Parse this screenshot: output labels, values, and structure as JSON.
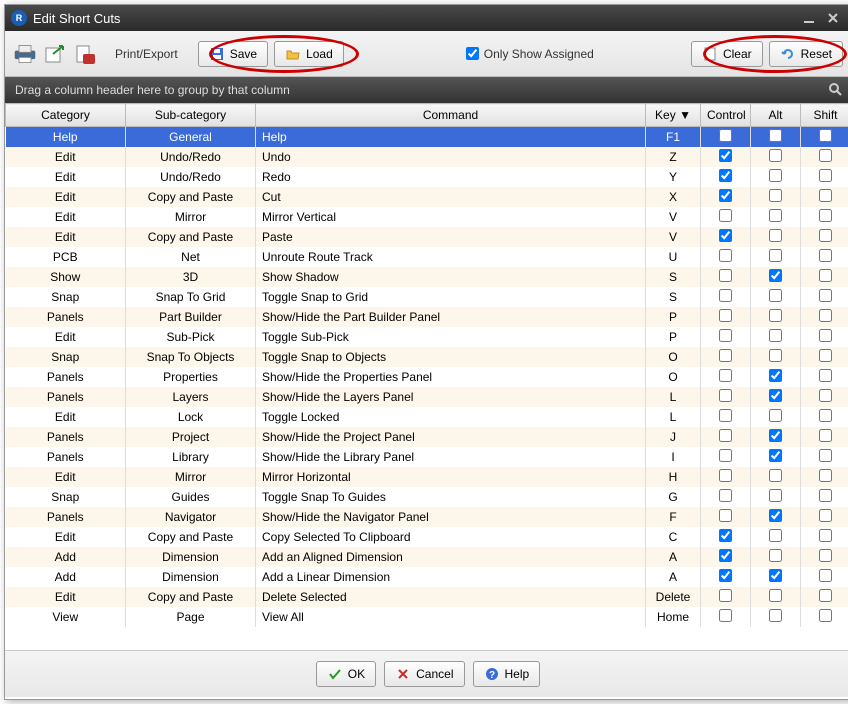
{
  "window": {
    "title": "Edit Short Cuts"
  },
  "toolbar": {
    "print_export_label": "Print/Export",
    "save_label": "Save",
    "load_label": "Load",
    "only_show_assigned_label": "Only Show Assigned",
    "only_show_assigned_checked": true,
    "clear_label": "Clear",
    "reset_label": "Reset"
  },
  "group_hint": "Drag a column header here to group by that column",
  "columns": {
    "category": "Category",
    "sub_category": "Sub-category",
    "command": "Command",
    "key": "Key",
    "control": "Control",
    "alt": "Alt",
    "shift": "Shift"
  },
  "rows": [
    {
      "category": "Help",
      "sub": "General",
      "command": "Help",
      "key": "F1",
      "ctrl": false,
      "alt": false,
      "shift": false,
      "selected": true
    },
    {
      "category": "Edit",
      "sub": "Undo/Redo",
      "command": "Undo",
      "key": "Z",
      "ctrl": true,
      "alt": false,
      "shift": false
    },
    {
      "category": "Edit",
      "sub": "Undo/Redo",
      "command": "Redo",
      "key": "Y",
      "ctrl": true,
      "alt": false,
      "shift": false
    },
    {
      "category": "Edit",
      "sub": "Copy and Paste",
      "command": "Cut",
      "key": "X",
      "ctrl": true,
      "alt": false,
      "shift": false
    },
    {
      "category": "Edit",
      "sub": "Mirror",
      "command": "Mirror Vertical",
      "key": "V",
      "ctrl": false,
      "alt": false,
      "shift": false
    },
    {
      "category": "Edit",
      "sub": "Copy and Paste",
      "command": "Paste",
      "key": "V",
      "ctrl": true,
      "alt": false,
      "shift": false
    },
    {
      "category": "PCB",
      "sub": "Net",
      "command": "Unroute Route Track",
      "key": "U",
      "ctrl": false,
      "alt": false,
      "shift": false
    },
    {
      "category": "Show",
      "sub": "3D",
      "command": "Show Shadow",
      "key": "S",
      "ctrl": false,
      "alt": true,
      "shift": false
    },
    {
      "category": "Snap",
      "sub": "Snap To Grid",
      "command": "Toggle Snap to Grid",
      "key": "S",
      "ctrl": false,
      "alt": false,
      "shift": false
    },
    {
      "category": "Panels",
      "sub": "Part Builder",
      "command": "Show/Hide the Part Builder Panel",
      "key": "P",
      "ctrl": false,
      "alt": false,
      "shift": false
    },
    {
      "category": "Edit",
      "sub": "Sub-Pick",
      "command": "Toggle Sub-Pick",
      "key": "P",
      "ctrl": false,
      "alt": false,
      "shift": false
    },
    {
      "category": "Snap",
      "sub": "Snap To Objects",
      "command": "Toggle Snap to Objects",
      "key": "O",
      "ctrl": false,
      "alt": false,
      "shift": false
    },
    {
      "category": "Panels",
      "sub": "Properties",
      "command": "Show/Hide the Properties Panel",
      "key": "O",
      "ctrl": false,
      "alt": true,
      "shift": false
    },
    {
      "category": "Panels",
      "sub": "Layers",
      "command": "Show/Hide the Layers Panel",
      "key": "L",
      "ctrl": false,
      "alt": true,
      "shift": false
    },
    {
      "category": "Edit",
      "sub": "Lock",
      "command": "Toggle Locked",
      "key": "L",
      "ctrl": false,
      "alt": false,
      "shift": false
    },
    {
      "category": "Panels",
      "sub": "Project",
      "command": "Show/Hide the Project Panel",
      "key": "J",
      "ctrl": false,
      "alt": true,
      "shift": false
    },
    {
      "category": "Panels",
      "sub": "Library",
      "command": "Show/Hide the Library Panel",
      "key": "I",
      "ctrl": false,
      "alt": true,
      "shift": false
    },
    {
      "category": "Edit",
      "sub": "Mirror",
      "command": "Mirror Horizontal",
      "key": "H",
      "ctrl": false,
      "alt": false,
      "shift": false
    },
    {
      "category": "Snap",
      "sub": "Guides",
      "command": "Toggle Snap To Guides",
      "key": "G",
      "ctrl": false,
      "alt": false,
      "shift": false
    },
    {
      "category": "Panels",
      "sub": "Navigator",
      "command": "Show/Hide the Navigator Panel",
      "key": "F",
      "ctrl": false,
      "alt": true,
      "shift": false
    },
    {
      "category": "Edit",
      "sub": "Copy and Paste",
      "command": "Copy Selected To Clipboard",
      "key": "C",
      "ctrl": true,
      "alt": false,
      "shift": false
    },
    {
      "category": "Add",
      "sub": "Dimension",
      "command": "Add an Aligned Dimension",
      "key": "A",
      "ctrl": true,
      "alt": false,
      "shift": false
    },
    {
      "category": "Add",
      "sub": "Dimension",
      "command": "Add a Linear Dimension",
      "key": "A",
      "ctrl": true,
      "alt": true,
      "shift": false
    },
    {
      "category": "Edit",
      "sub": "Copy and Paste",
      "command": "Delete Selected",
      "key": "Delete",
      "ctrl": false,
      "alt": false,
      "shift": false
    },
    {
      "category": "View",
      "sub": "Page",
      "command": "View All",
      "key": "Home",
      "ctrl": false,
      "alt": false,
      "shift": false
    }
  ],
  "footer": {
    "ok": "OK",
    "cancel": "Cancel",
    "help": "Help"
  }
}
